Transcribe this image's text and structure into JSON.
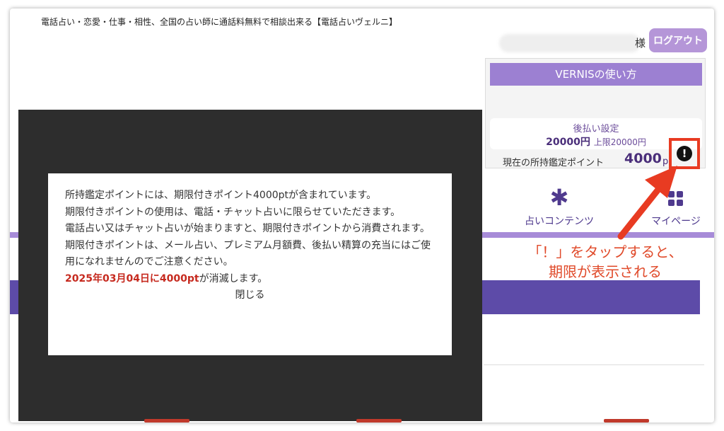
{
  "header": {
    "tagline": "電話占い・恋愛・仕事・相性、全国の占い師に通話料無料で相談出来る【電話占いヴェルニ】",
    "honorific": "様",
    "logout_label": "ログアウト"
  },
  "panel": {
    "howto_label": "VERNISの使い方",
    "deferred_title": "後払い設定",
    "deferred_amount": "20000円",
    "deferred_limit": "上限20000円",
    "points_label": "現在の所持鑑定ポイント",
    "points_value": "4000",
    "points_unit": "p",
    "info_icon": "!"
  },
  "nav": {
    "fortune_label": "占いコンテンツ",
    "fortune_icon": "✱",
    "mypage_label": "マイページ"
  },
  "annotation": {
    "line1": "「！」をタップすると、",
    "line2": "期限が表示される"
  },
  "modal": {
    "line1": "所持鑑定ポイントには、期限付きポイント4000ptが含まれています。",
    "line2": "期限付きポイントの使用は、電話・チャット占いに限らせていただきます。",
    "line3": "電話占い又はチャット占いが始まりますと、期限付きポイントから消費されます。",
    "line4": "期限付きポイントは、メール占い、プレミアム月額費、後払い精算の充当にはご使用になれませんのでご注意ください。",
    "expire_highlight": "2025年03月04日に4000pt",
    "expire_suffix": "が消滅します。",
    "close_label": "閉じる"
  },
  "colors": {
    "accent_purple": "#9c80d2",
    "deep_purple": "#5d4ba8",
    "annotation_red": "#e04a2a",
    "expire_red": "#c62a1f"
  }
}
